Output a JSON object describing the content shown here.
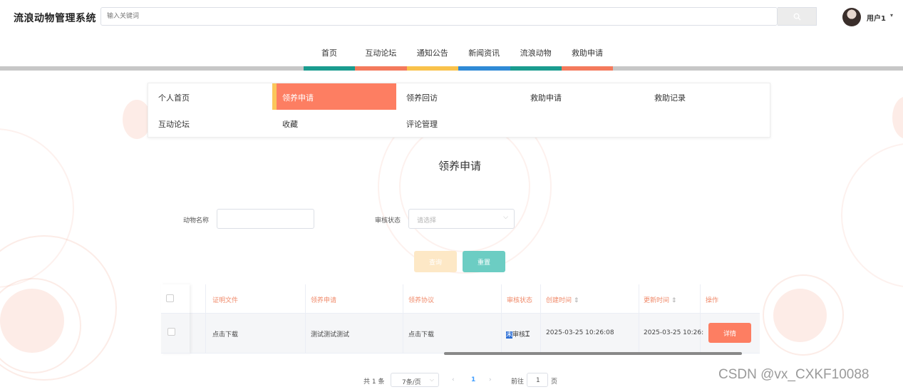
{
  "header": {
    "app_title": "流浪动物管理系统",
    "search_placeholder": "输入关键词",
    "username": "用户1"
  },
  "nav": {
    "items": [
      {
        "label": "首页",
        "color": "#1a9c8f"
      },
      {
        "label": "互动论坛",
        "color": "#f47a5c"
      },
      {
        "label": "通知公告",
        "color": "#f9c24b"
      },
      {
        "label": "新闻资讯",
        "color": "#2f8ad6"
      },
      {
        "label": "流浪动物",
        "color": "#1a9c8f"
      },
      {
        "label": "救助申请",
        "color": "#f47a5c"
      }
    ]
  },
  "submenu": {
    "items": [
      "个人首页",
      "领养申请",
      "领养回访",
      "救助申请",
      "救助记录",
      "互动论坛",
      "收藏",
      "评论管理"
    ],
    "active_index": 1
  },
  "page_title": "领养申请",
  "filters": {
    "animal_name_label": "动物名称",
    "animal_name_value": "",
    "status_label": "审核状态",
    "status_placeholder": "请选择",
    "query_button": "查询",
    "reset_button": "重置"
  },
  "table": {
    "headers": [
      "证明文件",
      "领养申请",
      "领养协议",
      "审核状态",
      "创建时间",
      "更新时间",
      "操作"
    ],
    "rows": [
      {
        "proof_file": "点击下载",
        "application": "测试测试测试",
        "agreement": "点击下载",
        "status_highlight": "未",
        "status_rest": "审核",
        "created": "2025-03-25 10:26:08",
        "updated": "2025-03-25 10:26:",
        "action": "详情"
      }
    ]
  },
  "pagination": {
    "total": "共 1 条",
    "page_size": "7条/页",
    "current_page": "1",
    "goto_label": "前往",
    "goto_value": "1",
    "page_unit": "页"
  },
  "watermark": "CSDN @vx_CXKF10088",
  "colors": {
    "accent": "#fd7e62",
    "query_button": "#fde8c6",
    "reset_button": "#6ccdc3"
  }
}
